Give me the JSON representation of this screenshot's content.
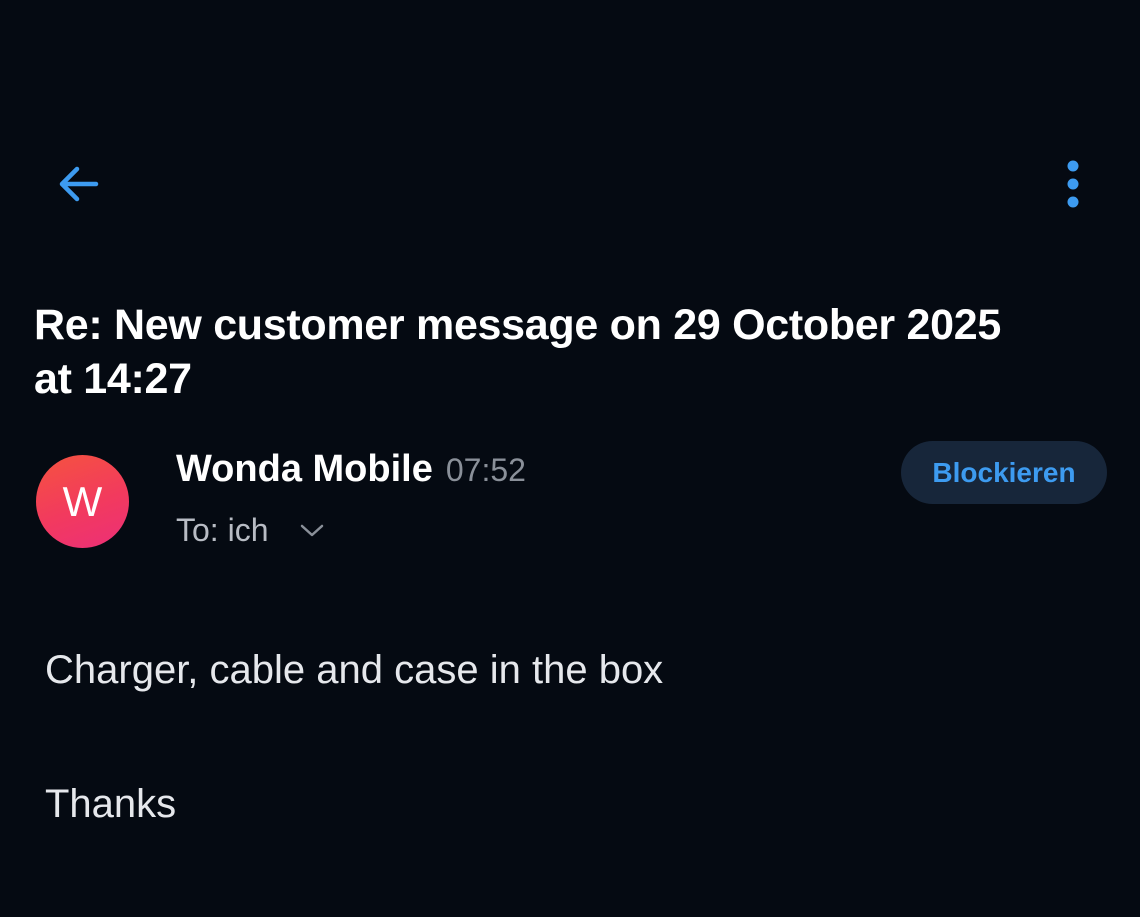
{
  "toolbar": {
    "back_icon": "arrow-left-icon",
    "more_icon": "more-vertical-icon",
    "icon_color": "#3d9bf0"
  },
  "email": {
    "subject": "Re: New customer message on 29 October 2025 at 14:27",
    "sender": {
      "avatar_letter": "W",
      "name": "Wonda Mobile",
      "time": "07:52"
    },
    "recipient": "To: ich",
    "block_label": "Blockieren",
    "body": {
      "line1": "Charger, cable and case in the box",
      "line2": "Thanks"
    }
  },
  "colors": {
    "background": "#050a12",
    "accent": "#3d9bf0",
    "block_button_bg": "#17263a",
    "avatar_gradient_start": "#f5533f",
    "avatar_gradient_end": "#ec2f78"
  }
}
